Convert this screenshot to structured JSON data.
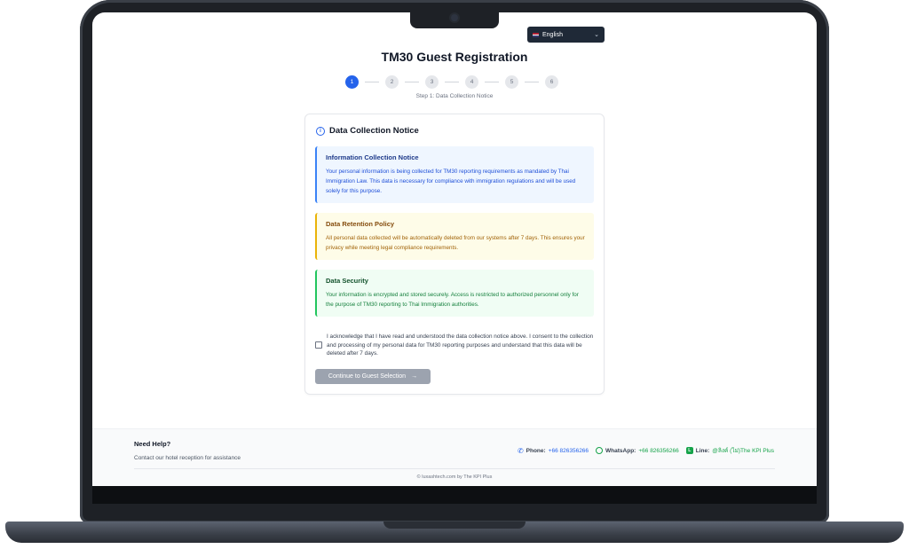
{
  "language": {
    "selected": "English",
    "flag_icon": "us-flag-icon"
  },
  "page": {
    "title": "TM30 Guest Registration"
  },
  "stepper": {
    "steps": [
      "1",
      "2",
      "3",
      "4",
      "5",
      "6"
    ],
    "active_step": 1,
    "caption": "Step 1: Data Collection Notice"
  },
  "card": {
    "title": "Data Collection Notice",
    "notices": [
      {
        "title": "Information Collection Notice",
        "text": "Your personal information is being collected for TM30 reporting requirements as mandated by Thai Immigration Law. This data is necessary for compliance with immigration regulations and will be used solely for this purpose.",
        "color": "#3b82f6"
      },
      {
        "title": "Data Retention Policy",
        "text": "All personal data collected will be automatically deleted from our systems after 7 days. This ensures your privacy while meeting legal compliance requirements.",
        "color": "#eab308"
      },
      {
        "title": "Data Security",
        "text": "Your information is encrypted and stored securely. Access is restricted to authorized personnel only for the purpose of TM30 reporting to Thai Immigration authorities.",
        "color": "#22c55e"
      }
    ],
    "acknowledge": "I acknowledge that I have read and understood the data collection notice above. I consent to the collection and processing of my personal data for TM30 reporting purposes and understand that this data will be deleted after 7 days.",
    "continue_label": "Continue to Guest Selection",
    "continue_arrow": "→"
  },
  "footer": {
    "help_title": "Need Help?",
    "help_sub": "Contact our hotel reception for assistance",
    "phone_label": "Phone:",
    "phone_value": "+66 826356266",
    "whatsapp_label": "WhatsApp:",
    "whatsapp_value": "+66 826356266",
    "line_label": "Line:",
    "line_value": "@ลิงค์ (ไม่)The KPI Plus",
    "copyright": "© luxashtech.com by The KPI Plus"
  },
  "colors": {
    "accent": "#2563eb",
    "button_disabled": "#9ca3af"
  }
}
